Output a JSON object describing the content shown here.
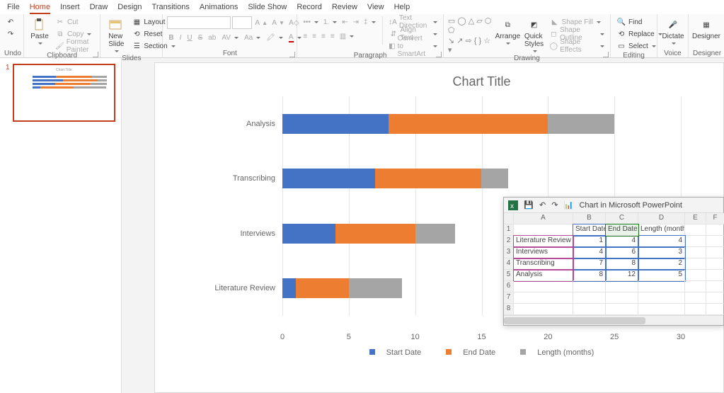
{
  "menu": [
    "File",
    "Home",
    "Insert",
    "Draw",
    "Design",
    "Transitions",
    "Animations",
    "Slide Show",
    "Record",
    "Review",
    "View",
    "Help"
  ],
  "menu_active": 1,
  "ribbon": {
    "undo": "Undo",
    "clipboard": {
      "label": "Clipboard",
      "paste": "Paste",
      "cut": "Cut",
      "copy": "Copy",
      "format_painter": "Format Painter"
    },
    "slides": {
      "label": "Slides",
      "new_slide": "New\nSlide",
      "layout": "Layout",
      "reset": "Reset",
      "section": "Section"
    },
    "font": {
      "label": "Font",
      "placeholder_font": "",
      "placeholder_size": ""
    },
    "paragraph": {
      "label": "Paragraph",
      "text_direction": "Text Direction",
      "align_text": "Align Text",
      "smartart": "Convert to SmartArt"
    },
    "drawing": {
      "label": "Drawing",
      "arrange": "Arrange",
      "quick_styles": "Quick\nStyles",
      "shape_fill": "Shape Fill",
      "shape_outline": "Shape Outline",
      "shape_effects": "Shape Effects"
    },
    "editing": {
      "label": "Editing",
      "find": "Find",
      "replace": "Replace",
      "select": "Select"
    },
    "voice": {
      "label": "Voice",
      "dictate": "Dictate"
    },
    "designer": {
      "label": "Designer",
      "designer": "Designer"
    }
  },
  "thumb_num": "1",
  "chart_data": {
    "type": "bar",
    "title": "Chart Title",
    "categories": [
      "Analysis",
      "Transcribing",
      "Interviews",
      "Literature Review"
    ],
    "series": [
      {
        "name": "Start Date",
        "values": [
          8,
          7,
          4,
          1
        ]
      },
      {
        "name": "End Date",
        "values": [
          12,
          8,
          6,
          4
        ]
      },
      {
        "name": "Length (months)",
        "values": [
          5,
          2,
          3,
          4
        ]
      }
    ],
    "xlabel": "",
    "ylabel": "",
    "xlim": [
      0,
      30
    ],
    "xticks": [
      0,
      5,
      10,
      15,
      20,
      25,
      30
    ]
  },
  "datasheet": {
    "title": "Chart in Microsoft PowerPoint",
    "cols": [
      "A",
      "B",
      "C",
      "D",
      "E",
      "F"
    ],
    "headers": [
      "",
      "Start Date",
      "End Date",
      "Length (months)"
    ],
    "rows": [
      [
        "Literature Review",
        1,
        4,
        4
      ],
      [
        "Interviews",
        4,
        6,
        3
      ],
      [
        "Transcribing",
        7,
        8,
        2
      ],
      [
        "Analysis",
        8,
        12,
        5
      ]
    ],
    "selected_cell": "C1"
  }
}
